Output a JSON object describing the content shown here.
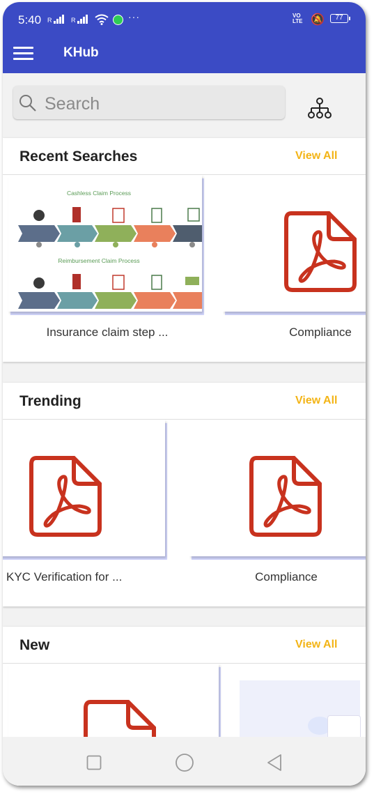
{
  "status_bar": {
    "time": "5:40",
    "signal_label": "R",
    "more_indicator": "···",
    "volte_line1": "VO",
    "volte_line2": "LTE",
    "battery": "77"
  },
  "app_bar": {
    "title": "KHub",
    "menu_icon": "menu-icon"
  },
  "search": {
    "placeholder": "Search",
    "hierarchy_icon": "org-tree-icon"
  },
  "sections": [
    {
      "title": "Recent Searches",
      "view_all": "View All",
      "cards": [
        {
          "label": "Insurance claim step ...",
          "thumbnail": "image",
          "diagram": {
            "title_1": "Cashless Claim Process",
            "title_2": "Reimbursement Claim Process"
          }
        },
        {
          "label": "Compliance",
          "thumbnail": "pdf"
        }
      ]
    },
    {
      "title": "Trending",
      "view_all": "View All",
      "cards": [
        {
          "label": "KYC Verification for ...",
          "thumbnail": "pdf"
        },
        {
          "label": "Compliance",
          "thumbnail": "pdf"
        }
      ]
    },
    {
      "title": "New",
      "view_all": "View All",
      "cards": [
        {
          "label": "",
          "thumbnail": "pdf"
        },
        {
          "label": "",
          "thumbnail": "image"
        }
      ]
    }
  ],
  "colors": {
    "app_bar": "#3b4bc5",
    "accent_view_all": "#f3b416",
    "pdf_red": "#c8321e",
    "card_shadow_tint": "#d4d8ff"
  },
  "nav_bar": {
    "icons": [
      "recents-square-icon",
      "home-circle-icon",
      "back-triangle-icon"
    ]
  }
}
